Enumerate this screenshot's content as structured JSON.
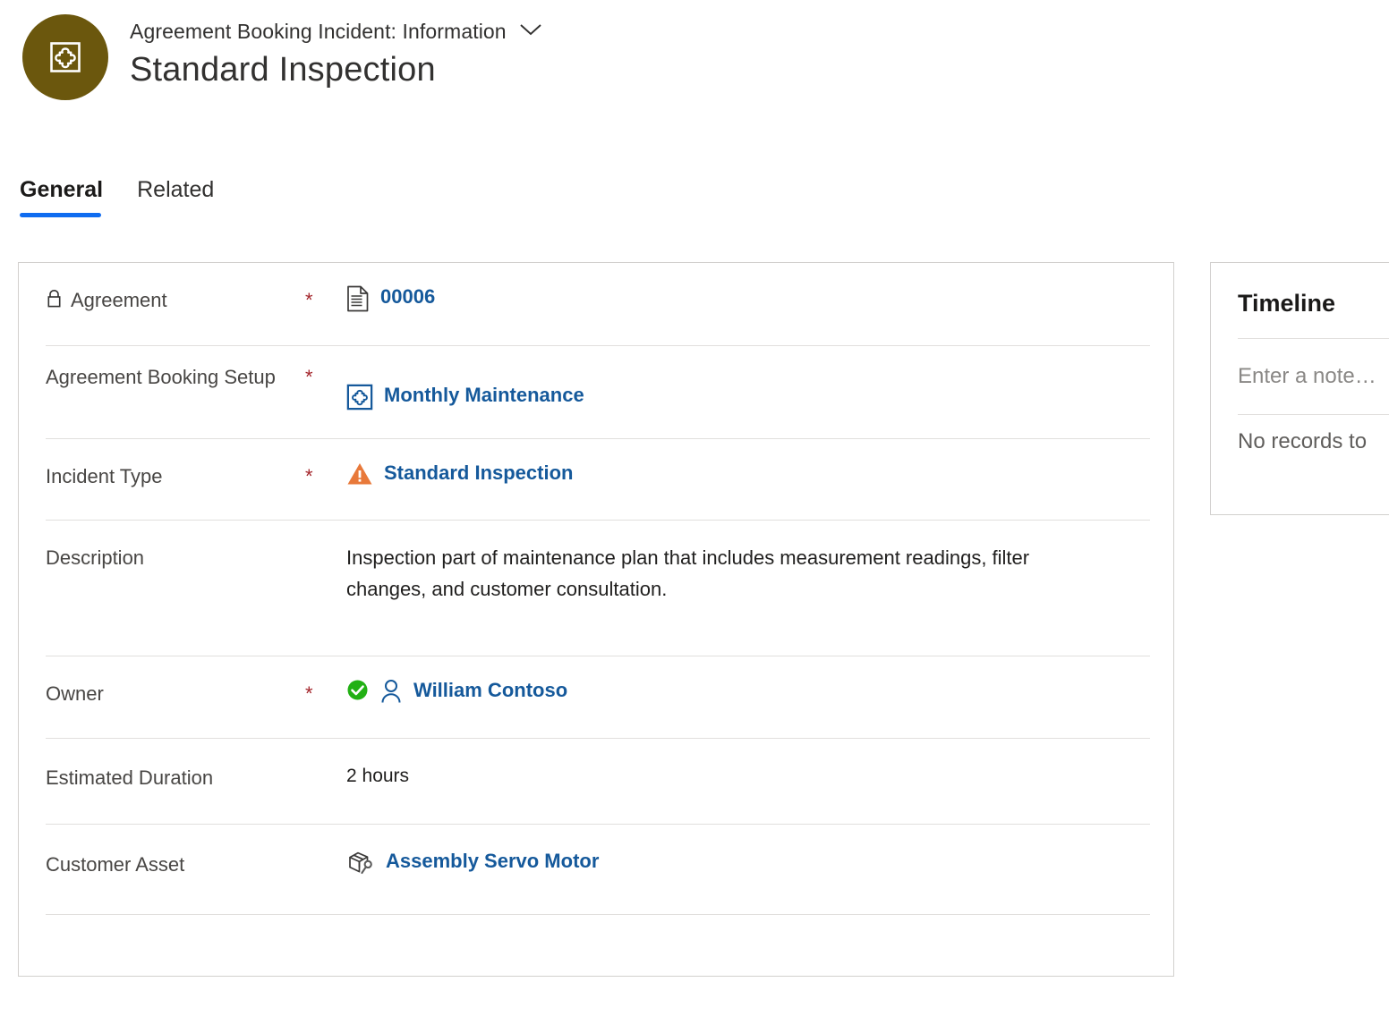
{
  "header": {
    "entity_label": "Agreement Booking Incident: Information",
    "record_title": "Standard Inspection",
    "avatar_icon": "puzzle-square-icon",
    "avatar_color": "#6b570d",
    "chevron_icon": "chevron-down-icon"
  },
  "tabs": [
    {
      "label": "General",
      "active": true
    },
    {
      "label": "Related",
      "active": false
    }
  ],
  "accent_color": "#0f6cf0",
  "link_color": "#15599b",
  "required_color": "#a4262c",
  "form": {
    "rows": [
      {
        "label": "Agreement",
        "required": "*",
        "lock_icon": "lock-icon",
        "value_icon": "document-icon",
        "value": "00006",
        "value_kind": "link"
      },
      {
        "label": "Agreement Booking Setup",
        "required": "*",
        "value_icon": "puzzle-square-icon",
        "value": "Monthly Maintenance",
        "value_kind": "link"
      },
      {
        "label": "Incident Type",
        "required": "*",
        "value_icon": "warning-triangle-icon",
        "value": "Standard Inspection",
        "value_kind": "link"
      },
      {
        "label": "Description",
        "required": "",
        "value": "Inspection part of maintenance plan that includes measurement readings, filter changes, and customer consultation.",
        "value_kind": "text"
      },
      {
        "label": "Owner",
        "required": "*",
        "value_icon": "green-check-icon",
        "value_icon2": "person-icon",
        "value": "William Contoso",
        "value_kind": "link"
      },
      {
        "label": "Estimated Duration",
        "required": "",
        "value": "2 hours",
        "value_kind": "plain"
      },
      {
        "label": "Customer Asset",
        "required": "",
        "value_icon": "asset-box-wrench-icon",
        "value": "Assembly Servo Motor",
        "value_kind": "link"
      }
    ]
  },
  "timeline": {
    "title": "Timeline",
    "note_placeholder": "Enter a note…",
    "empty_message": "No records to"
  }
}
